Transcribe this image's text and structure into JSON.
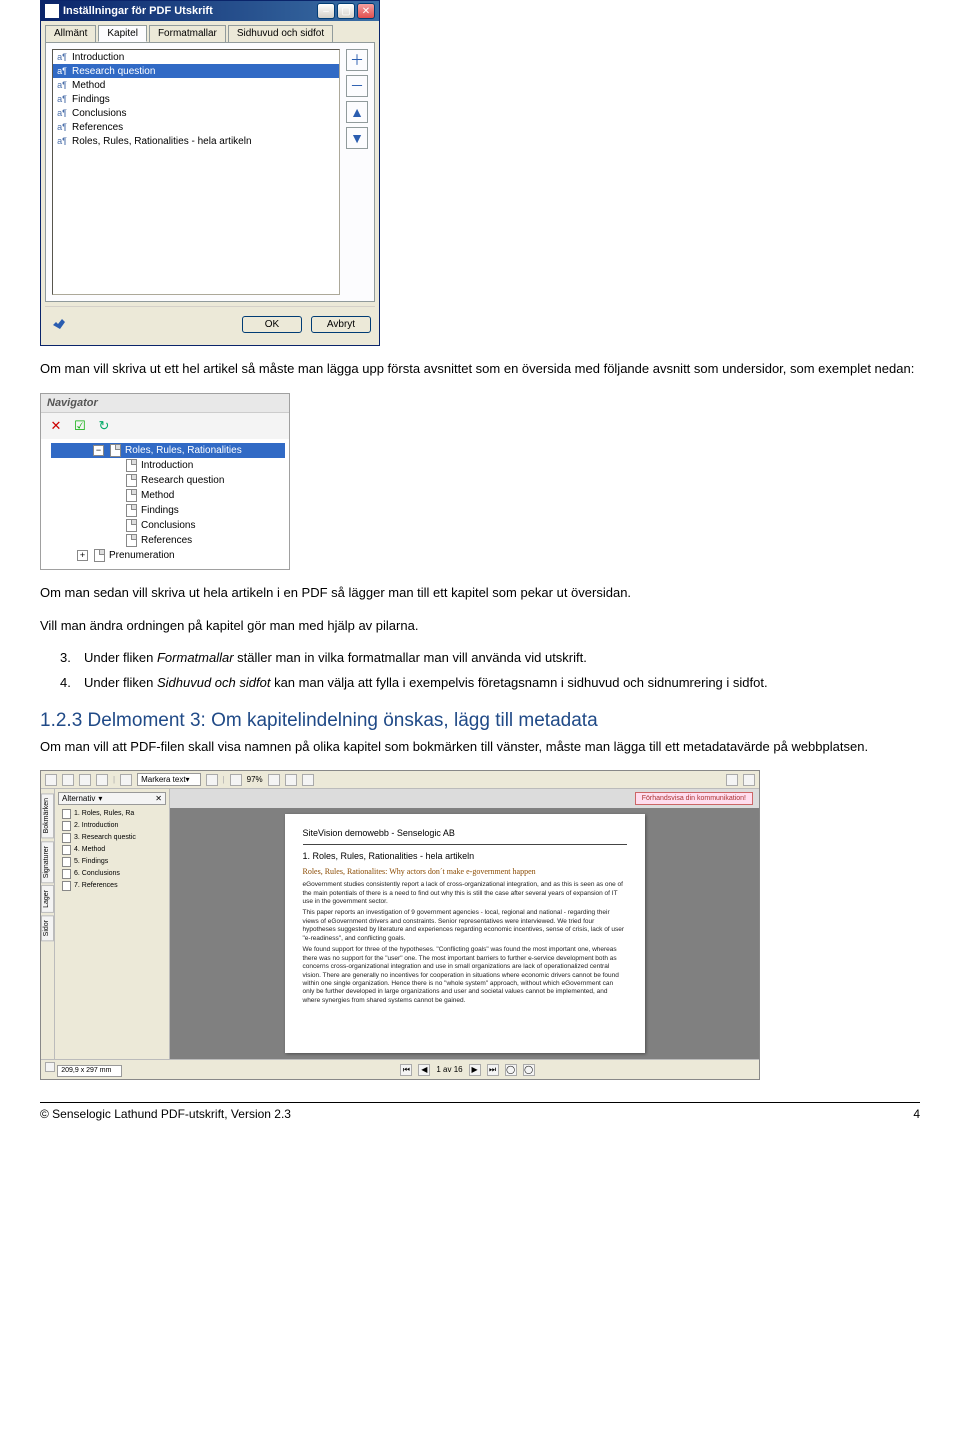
{
  "dialog": {
    "title": "Inställningar för PDF Utskrift",
    "tabs": [
      "Allmänt",
      "Kapitel",
      "Formatmallar",
      "Sidhuvud och sidfot"
    ],
    "activeTab": 1,
    "chapters": [
      "Introduction",
      "Research question",
      "Method",
      "Findings",
      "Conclusions",
      "References",
      "Roles, Rules, Rationalities - hela artikeln"
    ],
    "selectedChapter": 1,
    "ok": "OK",
    "cancel": "Avbryt"
  },
  "paragraphs": {
    "p1": "Om man vill skriva ut ett hel artikel så måste man lägga upp första avsnittet som en översida med följande avsnitt som undersidor, som exemplet nedan:",
    "p2": "Om man sedan vill skriva ut hela artikeln i en PDF så lägger man till ett kapitel som pekar ut översidan.",
    "p3": "Vill man ändra ordningen på kapitel gör man med hjälp av pilarna.",
    "li3_pre": "Under fliken ",
    "li3_em": "Formatmallar",
    "li3_post": " ställer man in vilka formatmallar man vill använda vid utskrift.",
    "li4_pre": "Under fliken ",
    "li4_em": "Sidhuvud och sidfot",
    "li4_post": " kan man välja att fylla i exempelvis företagsnamn i sidhuvud och sidnumrering i sidfot."
  },
  "navigator": {
    "title": "Navigator",
    "root": "Roles, Rules, Rationalities",
    "children": [
      "Introduction",
      "Research question",
      "Method",
      "Findings",
      "Conclusions",
      "References"
    ],
    "sibling": "Prenumeration"
  },
  "heading123": "1.2.3 Delmoment 3: Om kapitelindelning önskas, lägg till metadata",
  "heading123_body": "Om man vill att PDF-filen skall visa namnen på olika kapitel som bokmärken till vänster, måste man lägga till ett metadatavärde på webbplatsen.",
  "sv": {
    "altLabel": "Alternativ",
    "dropdown": "Markera text",
    "zoom": "97%",
    "previewBtn": "Förhandsvisa din kommunikation!",
    "tree": [
      "1. Roles, Rules, Ra",
      "2. Introduction",
      "3. Research questic",
      "4. Method",
      "5. Findings",
      "6. Conclusions",
      "7. References"
    ],
    "vtabs": [
      "Bokmärken",
      "Signaturer",
      "Lager",
      "Sidor"
    ],
    "doc": {
      "h1": "SiteVision demowebb - Senselogic AB",
      "h2": "1. Roles, Rules, Rationalities - hela artikeln",
      "h3": "Roles, Rules, Rationalites: Why actors don´t make e-government happen",
      "para1": "eGovernment studies consistently report a lack of cross-organizational integration, and as this is seen as one of the main potentials of there is a need to find out why this is still the case after several years of expansion of IT use in the government sector.",
      "para2": "This paper reports an investigation of 9 government agencies - local, regional and national - regarding their views of eGovernment drivers and constraints. Senior representatives were interviewed. We tried four hypotheses suggested by literature and experiences regarding economic incentives, sense of crisis, lack of user \"e-readiness\", and conflicting goals.",
      "para3": "We found support for three of the hypotheses. \"Conflicting goals\" was found the most important one, whereas there was no support for the \"user\" one. The most important barriers to further e-service development both as concerns cross-organizational integration and use in small organizations are lack of operationalized central vision. There are generally no incentives for cooperation in situations where economic drivers cannot be found within one single organization. Hence there is no \"whole system\" approach, without which eGovernment can only be further developed in large organizations and user and societal values cannot be implemented, and where synergies from shared systems cannot be gained."
    },
    "dim": "209,9 x 297 mm",
    "page": "1 av 16"
  },
  "footer": {
    "left": "© Senselogic Lathund PDF-utskrift, Version 2.3",
    "right": "4"
  }
}
